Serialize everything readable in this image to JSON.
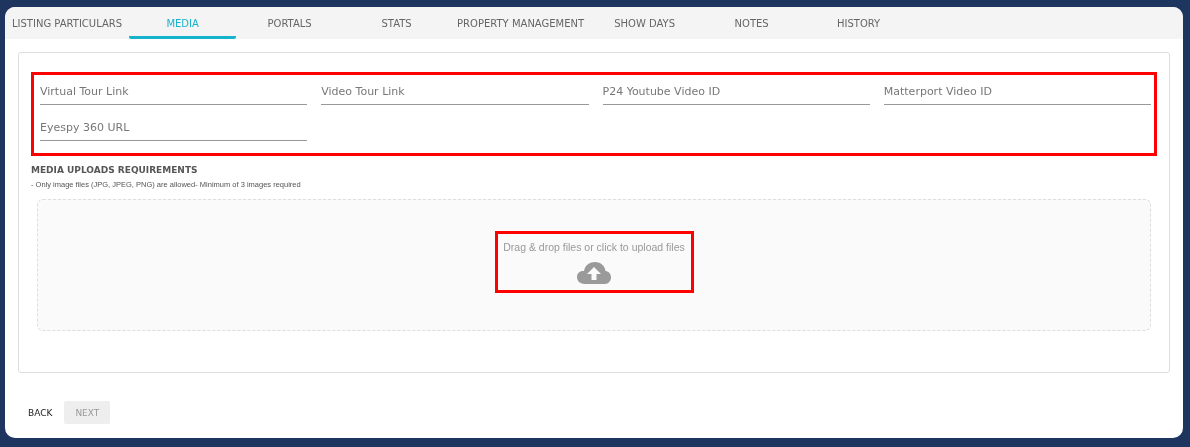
{
  "tabs": [
    {
      "label": "LISTING PARTICULARS",
      "selected": false
    },
    {
      "label": "MEDIA",
      "selected": true
    },
    {
      "label": "PORTALS",
      "selected": false
    },
    {
      "label": "STATS",
      "selected": false
    },
    {
      "label": "PROPERTY MANAGEMENT",
      "selected": false
    },
    {
      "label": "SHOW DAYS",
      "selected": false
    },
    {
      "label": "NOTES",
      "selected": false
    },
    {
      "label": "HISTORY",
      "selected": false
    }
  ],
  "fields": [
    {
      "placeholder": "Virtual Tour Link"
    },
    {
      "placeholder": "Video Tour Link"
    },
    {
      "placeholder": "P24 Youtube Video ID"
    },
    {
      "placeholder": "Matterport Video ID"
    },
    {
      "placeholder": "Eyespy 360 URL"
    }
  ],
  "requirements": {
    "title": "MEDIA UPLOADS REQUIREMENTS",
    "text": "- Only image files (JPG, JPEG, PNG) are allowed- Minimum of 3 images required"
  },
  "dropzone": {
    "text": "Drag & drop files or click to upload files"
  },
  "buttons": [
    {
      "label": "BACK",
      "disabled": false
    },
    {
      "label": "NEXT",
      "disabled": true
    }
  ]
}
